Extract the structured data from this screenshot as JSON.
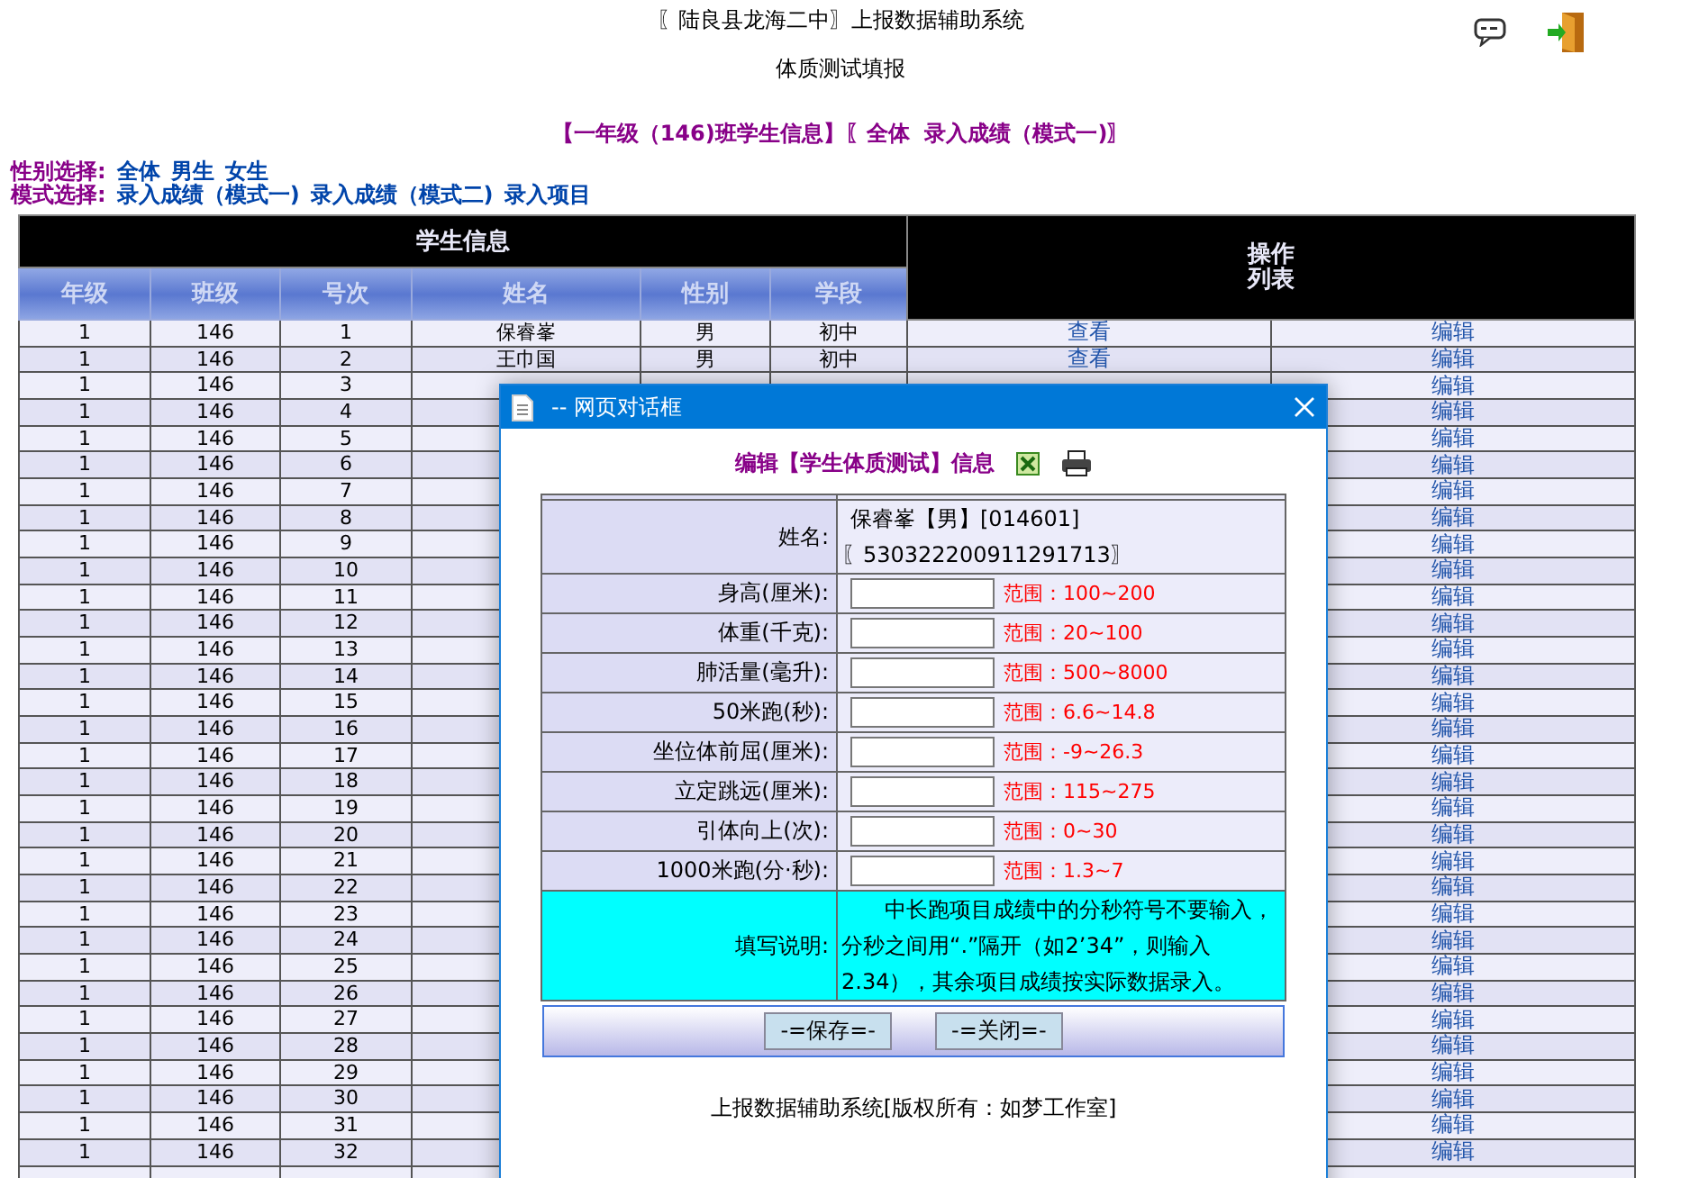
{
  "header": {
    "title": "〖陆良县龙海二中〗上报数据辅助系统",
    "subtitle": "体质测试填报",
    "class_info": "【一年级（146)班学生信息】〖全体  录入成绩（模式一)〗"
  },
  "filters": [
    {
      "label": "性别选择:",
      "options": [
        "全体",
        "男生",
        "女生"
      ]
    },
    {
      "label": "模式选择:",
      "options": [
        "录入成绩（模式一)",
        "录入成绩（模式二)",
        "录入项目"
      ]
    }
  ],
  "table": {
    "group_header": "学生信息",
    "ops_header": [
      "操作",
      "列表"
    ],
    "columns": [
      "年级",
      "班级",
      "号次",
      "姓名",
      "性别",
      "学段"
    ],
    "rows": [
      {
        "cells": [
          "1",
          "146",
          "1",
          "保睿峯",
          "男",
          "初中"
        ],
        "view": "查看",
        "edit": "编辑"
      },
      {
        "cells": [
          "1",
          "146",
          "2",
          "王巾国",
          "男",
          "初中"
        ],
        "view": "查看",
        "edit": "编辑"
      },
      {
        "cells": [
          "1",
          "146",
          "3"
        ],
        "edit": "编辑"
      },
      {
        "cells": [
          "1",
          "146",
          "4"
        ],
        "edit": "编辑"
      },
      {
        "cells": [
          "1",
          "146",
          "5"
        ],
        "edit": "编辑"
      },
      {
        "cells": [
          "1",
          "146",
          "6"
        ],
        "edit": "编辑"
      },
      {
        "cells": [
          "1",
          "146",
          "7"
        ],
        "edit": "编辑"
      },
      {
        "cells": [
          "1",
          "146",
          "8"
        ],
        "edit": "编辑"
      },
      {
        "cells": [
          "1",
          "146",
          "9"
        ],
        "edit": "编辑"
      },
      {
        "cells": [
          "1",
          "146",
          "10"
        ],
        "edit": "编辑"
      },
      {
        "cells": [
          "1",
          "146",
          "11"
        ],
        "edit": "编辑"
      },
      {
        "cells": [
          "1",
          "146",
          "12"
        ],
        "edit": "编辑"
      },
      {
        "cells": [
          "1",
          "146",
          "13"
        ],
        "edit": "编辑"
      },
      {
        "cells": [
          "1",
          "146",
          "14"
        ],
        "edit": "编辑"
      },
      {
        "cells": [
          "1",
          "146",
          "15"
        ],
        "edit": "编辑"
      },
      {
        "cells": [
          "1",
          "146",
          "16"
        ],
        "edit": "编辑"
      },
      {
        "cells": [
          "1",
          "146",
          "17"
        ],
        "edit": "编辑"
      },
      {
        "cells": [
          "1",
          "146",
          "18"
        ],
        "edit": "编辑"
      },
      {
        "cells": [
          "1",
          "146",
          "19"
        ],
        "edit": "编辑"
      },
      {
        "cells": [
          "1",
          "146",
          "20"
        ],
        "edit": "编辑"
      },
      {
        "cells": [
          "1",
          "146",
          "21"
        ],
        "edit": "编辑"
      },
      {
        "cells": [
          "1",
          "146",
          "22"
        ],
        "edit": "编辑"
      },
      {
        "cells": [
          "1",
          "146",
          "23"
        ],
        "edit": "编辑"
      },
      {
        "cells": [
          "1",
          "146",
          "24"
        ],
        "edit": "编辑"
      },
      {
        "cells": [
          "1",
          "146",
          "25"
        ],
        "edit": "编辑"
      },
      {
        "cells": [
          "1",
          "146",
          "26"
        ],
        "edit": "编辑"
      },
      {
        "cells": [
          "1",
          "146",
          "27"
        ],
        "edit": "编辑"
      },
      {
        "cells": [
          "1",
          "146",
          "28"
        ],
        "edit": "编辑"
      },
      {
        "cells": [
          "1",
          "146",
          "29"
        ],
        "edit": "编辑"
      },
      {
        "cells": [
          "1",
          "146",
          "30"
        ],
        "edit": "编辑"
      },
      {
        "cells": [
          "1",
          "146",
          "31"
        ],
        "edit": "编辑"
      },
      {
        "cells": [
          "1",
          "146",
          "32"
        ],
        "edit": "编辑"
      }
    ]
  },
  "dialog": {
    "title": "-- 网页对话框",
    "heading": "编辑【学生体质测试】信息",
    "name_label": "姓名:",
    "student": "保睿峯【男】[014601]",
    "id_number": "〖530322200911291713〗",
    "fields": [
      {
        "label": "身高(厘米):",
        "range": "范围：100~200"
      },
      {
        "label": "体重(千克):",
        "range": "范围：20~100"
      },
      {
        "label": "肺活量(毫升):",
        "range": "范围：500~8000"
      },
      {
        "label": "50米跑(秒):",
        "range": "范围：6.6~14.8"
      },
      {
        "label": "坐位体前屈(厘米):",
        "range": "范围：-9~26.3"
      },
      {
        "label": "立定跳远(厘米):",
        "range": "范围：115~275"
      },
      {
        "label": "引体向上(次):",
        "range": "范围：0~30"
      },
      {
        "label": "1000米跑(分·秒):",
        "range": "范围：1.3~7"
      }
    ],
    "note_label": "填写说明:",
    "note": "中长跑项目成绩中的分秒符号不要输入，分秒之间用“.”隔开（如2’34”，则输入2.34），其余项目成绩按实际数据录入。",
    "buttons": [
      "-=保存=-",
      "-=关闭=-"
    ],
    "footer": "上报数据辅助系统[版权所有：如梦工作室]"
  }
}
